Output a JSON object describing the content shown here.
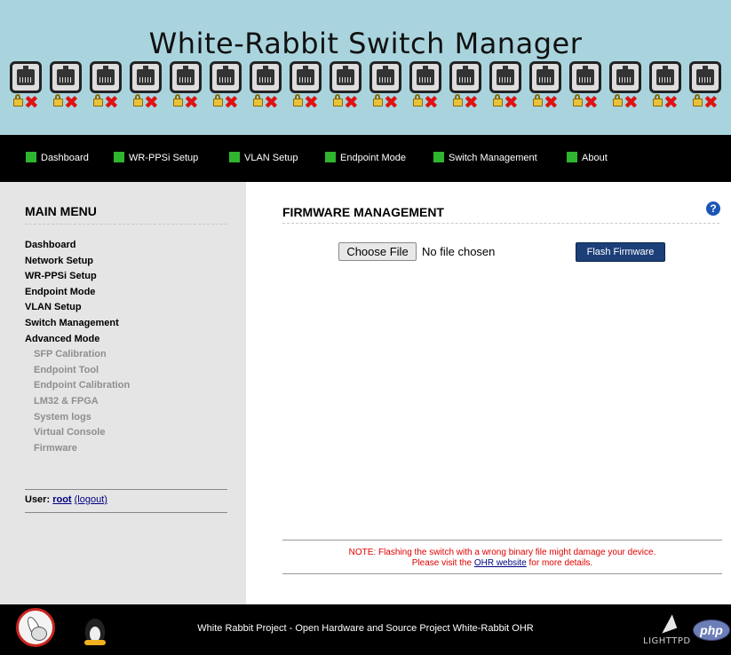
{
  "header": {
    "title": "White-Rabbit Switch Manager",
    "ports": [
      {
        "status": "down",
        "icons": [
          "port-icon",
          "lock-icon",
          "x-icon"
        ]
      },
      {
        "status": "down"
      },
      {
        "status": "down"
      },
      {
        "status": "down"
      },
      {
        "status": "down"
      },
      {
        "status": "down"
      },
      {
        "status": "down"
      },
      {
        "status": "down"
      },
      {
        "status": "down"
      },
      {
        "status": "down"
      },
      {
        "status": "down"
      },
      {
        "status": "down"
      },
      {
        "status": "down"
      },
      {
        "status": "down"
      },
      {
        "status": "down"
      },
      {
        "status": "down"
      },
      {
        "status": "down"
      },
      {
        "status": "down"
      }
    ],
    "port_down_glyph": "✖"
  },
  "topnav": {
    "items": [
      {
        "label": "Dashboard"
      },
      {
        "label": "WR-PPSi Setup"
      },
      {
        "label": "VLAN Setup"
      },
      {
        "label": "Endpoint Mode"
      },
      {
        "label": "Switch Management"
      },
      {
        "label": "About"
      }
    ],
    "indicator_color": "#2fb52f"
  },
  "sidebar": {
    "title": "MAIN MENU",
    "items": [
      {
        "label": "Dashboard"
      },
      {
        "label": "Network Setup"
      },
      {
        "label": "WR-PPSi Setup"
      },
      {
        "label": "Endpoint Mode"
      },
      {
        "label": "VLAN Setup"
      },
      {
        "label": "Switch Management"
      },
      {
        "label": "Advanced Mode"
      }
    ],
    "advanced_items": [
      {
        "label": "SFP Calibration"
      },
      {
        "label": "Endpoint Tool"
      },
      {
        "label": "Endpoint Calibration"
      },
      {
        "label": "LM32 & FPGA"
      },
      {
        "label": "System logs"
      },
      {
        "label": "Virtual Console"
      },
      {
        "label": "Firmware"
      }
    ],
    "user_label": "User:",
    "username": "root",
    "logout": "(logout)"
  },
  "main": {
    "title": "FIRMWARE MANAGEMENT",
    "help_glyph": "?",
    "choose_file_label": "Choose File",
    "no_file_text": "No file chosen",
    "flash_button_label": "Flash Firmware",
    "note_line1": "NOTE: Flashing the switch with a wrong binary file might damage your device.",
    "note_line2_prefix": "Please visit the",
    "note_link": "OHR website",
    "note_line2_suffix": "for more details."
  },
  "footer": {
    "text": "White Rabbit Project - Open Hardware and Source Project White-Rabbit OHR",
    "lighttpd_label": "LIGHTTPD",
    "php_label": "php"
  },
  "colors": {
    "banner_bg": "#a9d4de",
    "nav_bg": "#000000",
    "sidebar_bg": "#e5e5e5",
    "flash_button_bg": "#1c3f78",
    "note_text": "#e00000",
    "port_down": "#e01212"
  }
}
